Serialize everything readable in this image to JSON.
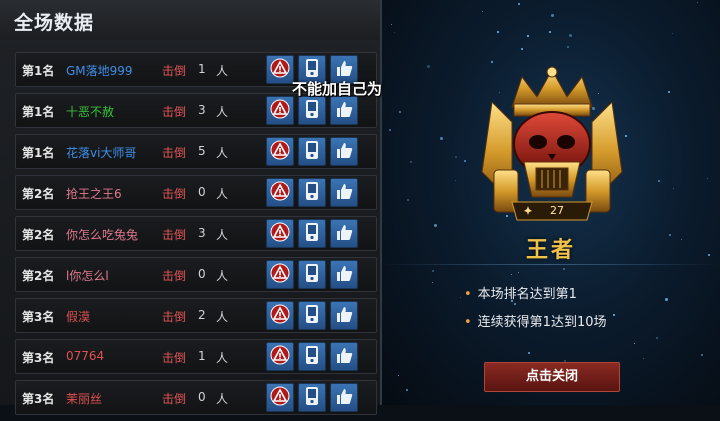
{
  "header": {
    "title": "全场数据"
  },
  "tooltip": "不能加自己为好友",
  "rows": [
    {
      "rank": "第1名",
      "name": "GM落地999",
      "name_color": "#3f8fe8",
      "kill_label": "击倒",
      "kills": "1",
      "unit": "人"
    },
    {
      "rank": "第1名",
      "name": "十恶不赦",
      "name_color": "#38c038",
      "kill_label": "击倒",
      "kills": "3",
      "unit": "人"
    },
    {
      "rank": "第1名",
      "name": "花落vi大师哥",
      "name_color": "#3f8fe8",
      "kill_label": "击倒",
      "kills": "5",
      "unit": "人"
    },
    {
      "rank": "第2名",
      "name": "抢王之王6",
      "name_color": "#e07a90",
      "kill_label": "击倒",
      "kills": "0",
      "unit": "人"
    },
    {
      "rank": "第2名",
      "name": "你怎么吃兔兔",
      "name_color": "#e07a90",
      "kill_label": "击倒",
      "kills": "3",
      "unit": "人"
    },
    {
      "rank": "第2名",
      "name": "l你怎么l",
      "name_color": "#e07a90",
      "kill_label": "击倒",
      "kills": "0",
      "unit": "人"
    },
    {
      "rank": "第3名",
      "name": "假漠",
      "name_color": "#e05050",
      "kill_label": "击倒",
      "kills": "2",
      "unit": "人"
    },
    {
      "rank": "第3名",
      "name": "07764",
      "name_color": "#e05050",
      "kill_label": "击倒",
      "kills": "1",
      "unit": "人"
    },
    {
      "rank": "第3名",
      "name": "茉丽丝",
      "name_color": "#e05050",
      "kill_label": "击倒",
      "kills": "0",
      "unit": "人"
    }
  ],
  "row_buttons": {
    "report": "warning-icon",
    "profile": "phone-icon",
    "like": "thumbs-up-icon"
  },
  "badge": {
    "level": "27",
    "title": "王者"
  },
  "achievements": [
    "本场排名达到第1",
    "连续获得第1达到10场"
  ],
  "close_button": "点击关闭",
  "colors": {
    "accent_gold": "#f0c24a",
    "button_blue": "#2f6aa8",
    "close_red": "#7a2018"
  }
}
